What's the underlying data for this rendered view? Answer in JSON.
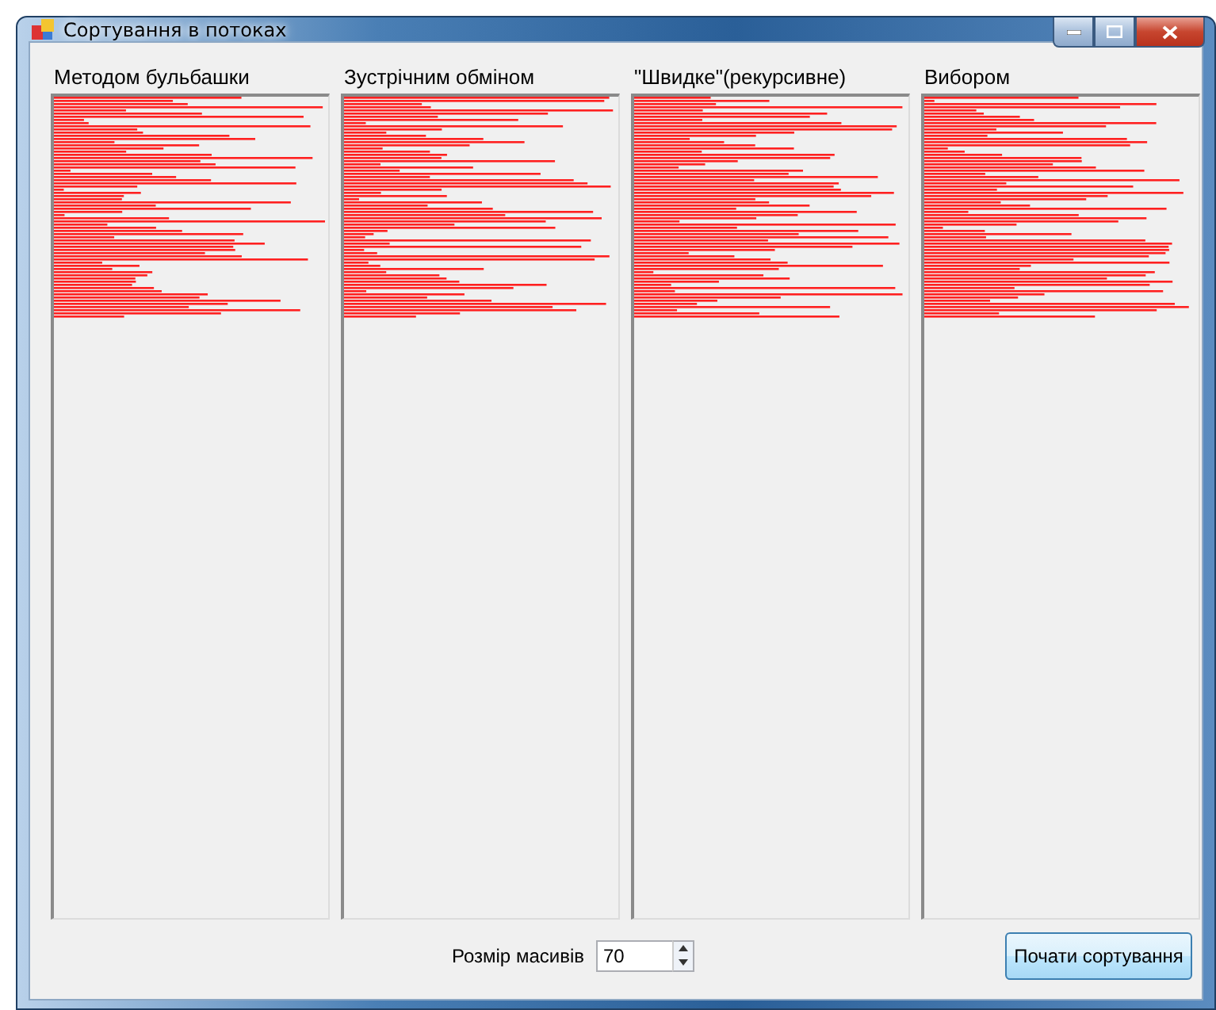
{
  "window": {
    "title": "Сортування в потоках"
  },
  "panels": [
    {
      "title": "Методом бульбашки"
    },
    {
      "title": "Зустрічним обміном"
    },
    {
      "title": "\"Швидке\"(рекурсивне)"
    },
    {
      "title": "Вибором"
    }
  ],
  "array_size": {
    "label": "Розмір масивів",
    "value": "70"
  },
  "start_button": {
    "label": "Почати сортування"
  }
}
